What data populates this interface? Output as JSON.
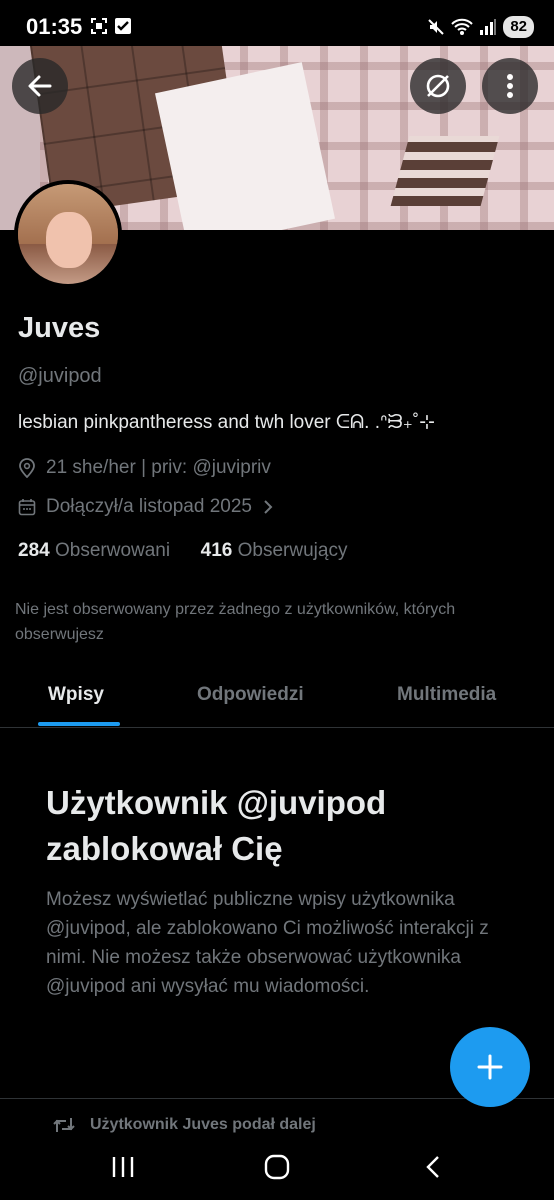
{
  "status_bar": {
    "time": "01:35",
    "battery": "82",
    "icons": [
      "screenshot-icon",
      "check-box-icon",
      "mute-icon",
      "wifi-icon",
      "signal-icon"
    ]
  },
  "header": {
    "back_icon": "arrow-left-icon",
    "grok_icon": "grok-icon",
    "more_icon": "more-vertical-icon"
  },
  "profile": {
    "name": "Juves",
    "handle": "@juvipod",
    "bio": "lesbian pinkpantheress and twh lover ᕮᕱ. .ᐢᙣ₊˚⊹",
    "location": "21 she/her | priv: @juvipriv",
    "joined": "Dołączył/a listopad 2025",
    "following_count": "284",
    "following_label": "Obserwowani",
    "followers_count": "416",
    "followers_label": "Obserwujący",
    "not_followed_note": "Nie jest obserwowany przez żadnego z użytkowników, których obserwujesz"
  },
  "tabs": [
    {
      "label": "Wpisy",
      "active": true
    },
    {
      "label": "Odpowiedzi",
      "active": false
    },
    {
      "label": "Multimedia",
      "active": false
    }
  ],
  "blocked": {
    "title": "Użytkownik @juvipod zablokował Cię",
    "text": "Możesz wyświetlać publiczne wpisy użytkownika @juvipod, ale zablokowano Ci możliwość interakcji z nimi. Nie możesz także obserwować użytkownika @juvipod ani wysyłać mu wiadomości."
  },
  "feed_peek": {
    "retweet_text": "Użytkownik Juves podał dalej"
  },
  "fab": {
    "icon": "plus-icon"
  },
  "colors": {
    "accent": "#1d9bf0",
    "text_primary": "#e7e9ea",
    "text_secondary": "#71767b",
    "background": "#000000"
  }
}
